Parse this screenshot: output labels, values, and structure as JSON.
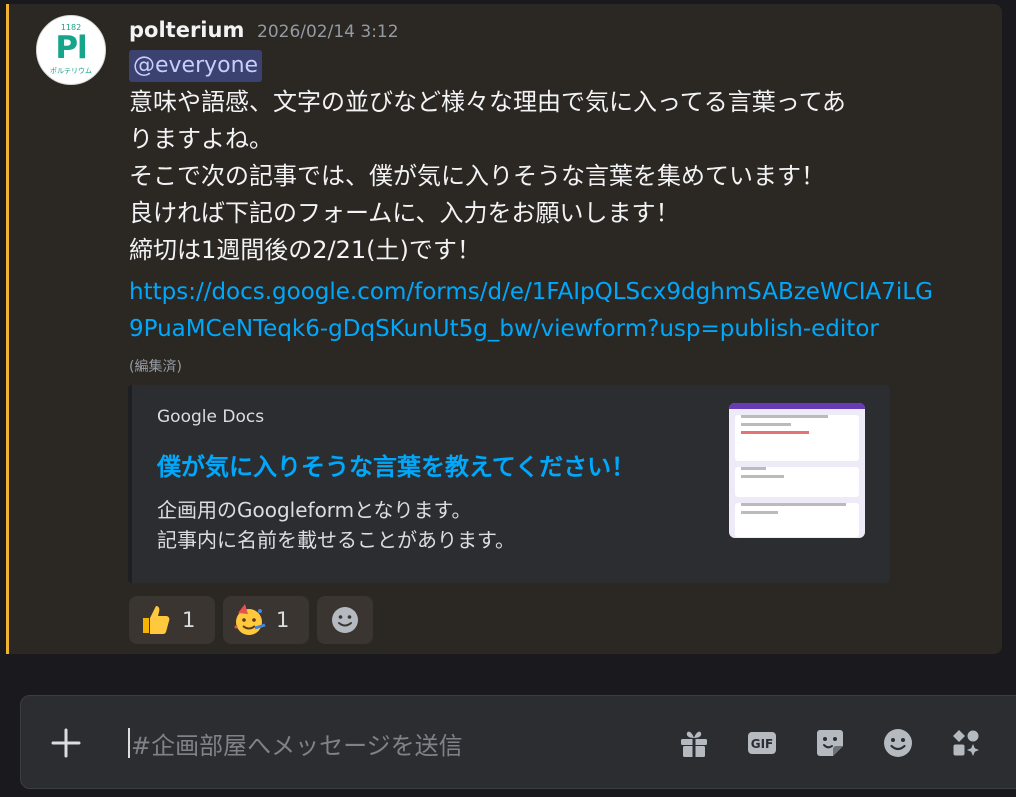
{
  "message": {
    "avatar": {
      "number": "1182",
      "symbol": "Pl",
      "name_jp": "ポルテリウム"
    },
    "username": "polterium",
    "timestamp": "2026/02/14 3:12",
    "mention": "@everyone",
    "lines": [
      "意味や語感、文字の並びなど様々な理由で気に入ってる言葉ってあ",
      "りますよね。",
      "そこで次の記事では、僕が気に入りそうな言葉を集めています！",
      "良ければ下記のフォームに、入力をお願いします！",
      "締切は1週間後の2/21(土)です！"
    ],
    "link_lines": [
      "https://docs.google.com/forms/d/e/1FAIpQLScx9dghmSABzeWCIA7iLG",
      "9PuaMCeNTeqk6-gDqSKunUt5g_bw/viewform?usp=publish-editor"
    ],
    "edited": "(編集済)",
    "embed": {
      "provider": "Google Docs",
      "title": "僕が気に入りそうな言葉を教えてください！",
      "description": [
        "企画用のGoogleformとなります。",
        "記事内に名前を載せることがあります。"
      ]
    },
    "reactions": [
      {
        "emoji": "thumbs-up-icon",
        "count": "1"
      },
      {
        "emoji": "party-face-icon",
        "count": "1"
      }
    ]
  },
  "composer": {
    "placeholder": "#企画部屋へメッセージを送信",
    "gif_label": "GIF"
  },
  "colors": {
    "message_bg": "#2b2722",
    "mention_accent": "#f0b232",
    "link": "#00a8fc",
    "avatar_green": "#17a589"
  }
}
